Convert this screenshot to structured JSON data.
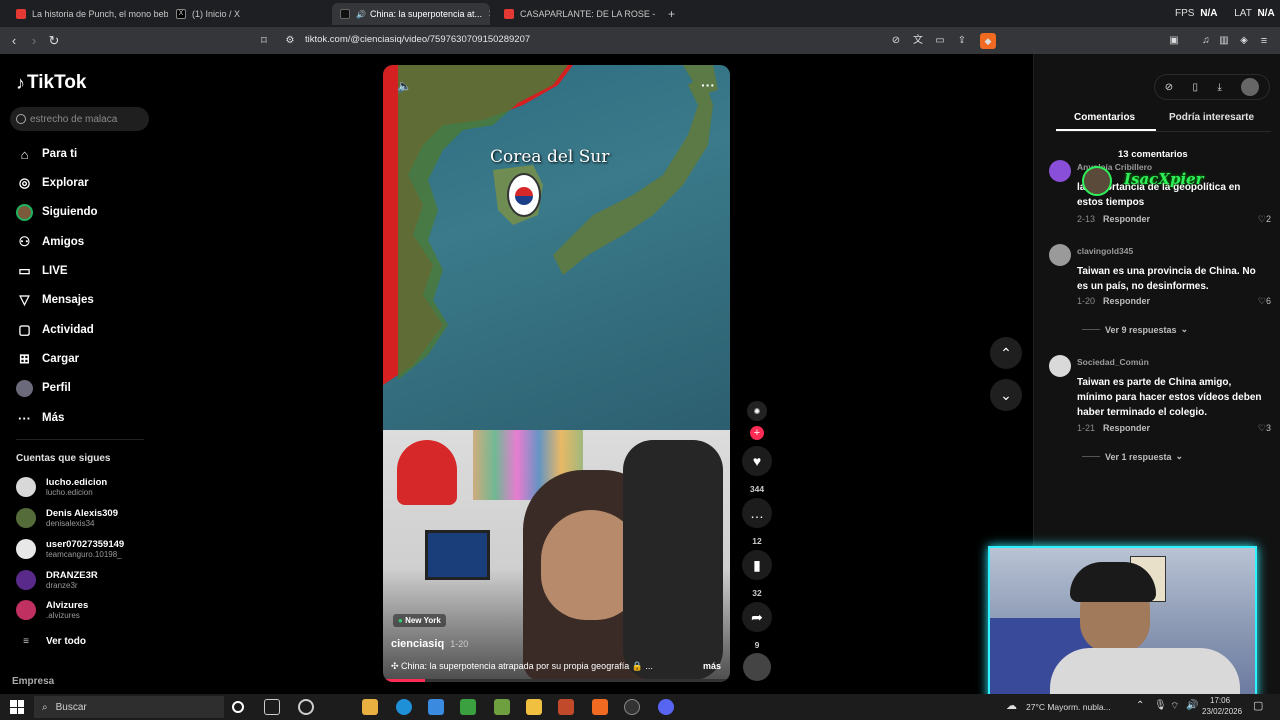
{
  "browser": {
    "tabs": [
      {
        "label": "La historia de Punch, el mono bebé, ...",
        "color": "#e53935"
      },
      {
        "label": "(1) Inicio / X",
        "color": "#ffffff"
      },
      {
        "label": "China: la superpotencia at...",
        "color": "#ffffff"
      },
      {
        "label": "CASAPARLANTE: DE LA ROSE - YouTu...",
        "color": "#e53935"
      }
    ],
    "new_tab": "+",
    "fps_label": "FPS",
    "fps_value": "N/A",
    "lat_label": "LAT",
    "lat_value": "N/A",
    "url": "tiktok.com/@cienciasiq/video/7597630709150289207"
  },
  "sidebar": {
    "logo": "TikTok",
    "search_placeholder": "estrecho de malaca",
    "nav": [
      {
        "label": "Para ti",
        "icon": "home-icon"
      },
      {
        "label": "Explorar",
        "icon": "compass-icon"
      },
      {
        "label": "Siguiendo",
        "icon": "avatar-icon"
      },
      {
        "label": "Amigos",
        "icon": "friends-icon"
      },
      {
        "label": "LIVE",
        "icon": "live-icon"
      },
      {
        "label": "Mensajes",
        "icon": "send-icon"
      },
      {
        "label": "Actividad",
        "icon": "activity-icon"
      },
      {
        "label": "Cargar",
        "icon": "upload-icon"
      },
      {
        "label": "Perfil",
        "icon": "profile-icon"
      },
      {
        "label": "Más",
        "icon": "more-icon"
      }
    ],
    "following_heading": "Cuentas que sigues",
    "following": [
      {
        "name": "lucho.edicion",
        "handle": "lucho.edicion",
        "color": "#d8d8d8"
      },
      {
        "name": "Denis Alexis309",
        "handle": "denisalexis34",
        "color": "#556b3a"
      },
      {
        "name": "user07027359149",
        "handle": "teamcanguro.10198_",
        "color": "#e8e8e8"
      },
      {
        "name": "DRANZE3R",
        "handle": "dranze3r",
        "color": "#5a2a8a"
      },
      {
        "name": "Alvizures",
        "handle": ".alvizures",
        "color": "#c03060"
      }
    ],
    "see_all": "Ver todo",
    "company": "Empresa"
  },
  "video": {
    "map_label": "Corea del Sur",
    "location": "New York",
    "author": "cienciasiq",
    "date": "1-20",
    "caption": "China: la superpotencia atrapada por su propia geografía 🔒 ...",
    "more": "más"
  },
  "actions": {
    "likes": "344",
    "comments": "12",
    "saves": "32",
    "shares": "9"
  },
  "panel": {
    "tab_comments": "Comentarios",
    "tab_interest": "Podría interesarte",
    "comment_count": "13 comentarios",
    "comments": [
      {
        "user": "Anyoleía Cribillero",
        "text": "la importancia de la geopolítica en estos tiempos",
        "date": "2-13",
        "reply": "Responder",
        "likes": "2",
        "color": "#8a4fd8"
      },
      {
        "user": "clavingold345",
        "text": "Taiwan es una provincia de China. No es un país, no desinformes.",
        "date": "1-20",
        "reply": "Responder",
        "likes": "6",
        "color": "#9a9a9a"
      },
      {
        "user": "Sociedad_Común",
        "text": "Taiwan es parte de China amigo, mínimo para hacer estos vídeos deben haber terminado el colegio.",
        "date": "1-21",
        "reply": "Responder",
        "likes": "3",
        "color": "#d9d9d9"
      }
    ],
    "replies_1": "Ver 9 respuestas",
    "replies_2": "Ver 1 respuesta"
  },
  "overlay_stamp": "IsacXpier",
  "taskbar": {
    "search": "Buscar",
    "weather": "27°C  Mayorm. nubla...",
    "time": "17:06",
    "date": "23/02/2026"
  }
}
